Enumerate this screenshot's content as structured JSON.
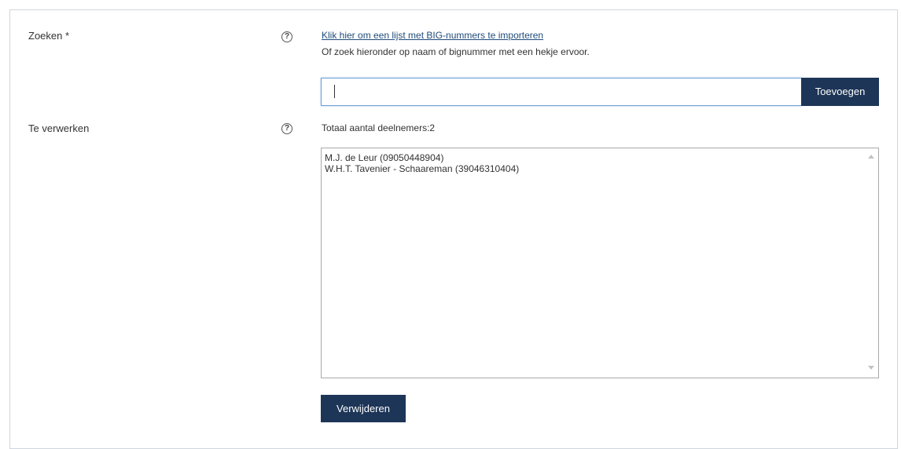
{
  "search_row": {
    "label": "Zoeken *",
    "help_icon": "?",
    "import_link": "Klik hier om een lijst met BIG-nummers te importeren",
    "hint": "Of zoek hieronder op naam of bignummer met een hekje ervoor.",
    "input_value": "",
    "add_button": "Toevoegen"
  },
  "process_row": {
    "label": "Te verwerken",
    "help_icon": "?",
    "total_text": "Totaal aantal deelnemers:2",
    "items": [
      "M.J. de Leur (09050448904)",
      "W.H.T. Tavenier - Schaareman (39046310404)"
    ],
    "remove_button": "Verwijderen"
  },
  "colors": {
    "primary_button": "#1d3557",
    "link": "#1f4b7a",
    "focus_border": "#6fa2d6"
  }
}
